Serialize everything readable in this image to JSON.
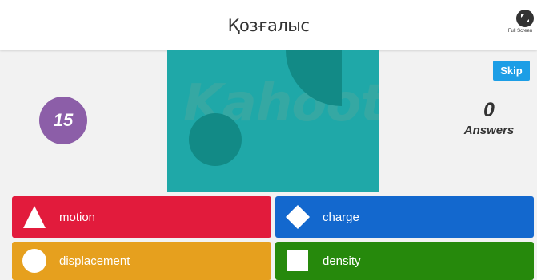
{
  "header": {
    "question_title": "Қозғалыс",
    "fullscreen_label": "Full Screen"
  },
  "timer": {
    "value": "15"
  },
  "answers_counter": {
    "count": "0",
    "label": "Answers"
  },
  "skip_button": {
    "label": "Skip"
  },
  "media": {
    "watermark_text": "Kahoot!"
  },
  "options": [
    {
      "label": "motion",
      "shape": "triangle-icon",
      "color": "#e21b3c"
    },
    {
      "label": "charge",
      "shape": "diamond-icon",
      "color": "#1368ce"
    },
    {
      "label": "displacement",
      "shape": "circle-icon",
      "color": "#e6a01e"
    },
    {
      "label": "density",
      "shape": "square-icon",
      "color": "#26890c"
    }
  ]
}
